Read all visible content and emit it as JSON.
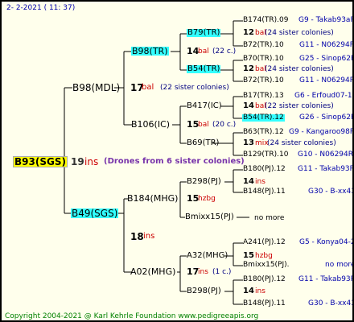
{
  "header": {
    "date": "2-  2-2021 ( 11: 37)"
  },
  "root": {
    "name": "B93(SGS)",
    "year": "19",
    "mark": "ins",
    "drones": "(Drones from 6 sister colonies)"
  },
  "gen1": {
    "top": {
      "name": "B98(MDL)",
      "year": "17",
      "mark": "bal",
      "note": "(22 sister colonies)"
    },
    "bottom": {
      "name": "B49(SGS)",
      "year": "18",
      "mark": "ins"
    }
  },
  "gen2": [
    {
      "name": "B98(TR)",
      "year": "14",
      "mark": "bal",
      "note": "(22 c.)"
    },
    {
      "name": "B106(IC)",
      "year": "15",
      "mark": "bal",
      "note": "(20 c.)"
    },
    {
      "name": "B184(MHG)",
      "year": "15",
      "mark": "hzbg"
    },
    {
      "name": "A02(MHG)",
      "year": "17",
      "mark": "ins",
      "note": "(1 c.)"
    }
  ],
  "gen3": [
    {
      "name": "B79(TR)",
      "year": "12",
      "mark": "bal",
      "note": "(24 sister colonies)"
    },
    {
      "name": "B54(TR)",
      "year": "12",
      "mark": "bal",
      "note": "(24 sister colonies)"
    },
    {
      "name": "B417(IC)",
      "year": "14",
      "mark": "bal",
      "note": "(22 sister colonies)"
    },
    {
      "name": "B69(TR)",
      "year": "13",
      "mark": "mix",
      "note": "(24 sister colonies)"
    },
    {
      "name": "B298(PJ)",
      "year": "14",
      "mark": "ins"
    },
    {
      "name": "Bmixx15(PJ)",
      "note": "no more"
    },
    {
      "name": "A32(MHG)",
      "year": "15",
      "mark": "hzbg"
    },
    {
      "name": "B298(PJ)",
      "year": "14",
      "mark": "ins"
    }
  ],
  "gen4": [
    {
      "name": "B174(TR).09",
      "breeder": "G9 - Takab93aR"
    },
    {
      "name": "B72(TR).10",
      "breeder": "G11 - N06294R"
    },
    {
      "name": "B70(TR).10",
      "breeder": "G25 - Sinop62R"
    },
    {
      "name": "B72(TR).10",
      "breeder": "G11 - N06294R"
    },
    {
      "name": "B17(TR).13",
      "breeder": "G6 - Erfoud07-1Q"
    },
    {
      "name": "B54(TR).12",
      "breeder": "G26 - Sinop62R"
    },
    {
      "name": "B63(TR).12",
      "breeder": "G9 - Kangaroo98R"
    },
    {
      "name": "B129(TR).10",
      "breeder": "G10 - N06294R"
    },
    {
      "name": "B180(PJ).12",
      "breeder": "G11 - Takab93R"
    },
    {
      "name": "B148(PJ).11",
      "breeder": "G30 - B-xx43"
    },
    {
      "name": "A241(PJ).12",
      "breeder": "G5 - Konya04-2"
    },
    {
      "name": "Bmixx15(PJ).",
      "breeder": "no more"
    },
    {
      "name": "B180(PJ).12",
      "breeder": "G11 - Takab93R"
    },
    {
      "name": "B148(PJ).11",
      "breeder": "G30 - B-xx43"
    }
  ],
  "footer": {
    "text": "Copyright 2004-2021 @ Karl Kehrle Foundation    www.pedigreeapis.org"
  }
}
